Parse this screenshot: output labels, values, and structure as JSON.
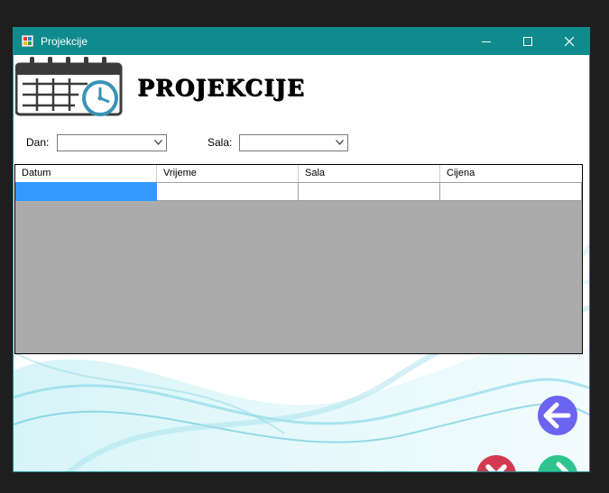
{
  "window": {
    "title": "Projekcije",
    "icon": "app-icon",
    "controls": [
      "minimize-icon",
      "maximize-icon",
      "close-icon"
    ]
  },
  "header": {
    "title": "PROJEKCIJE",
    "logo_icon": "calendar-clock-icon"
  },
  "filters": {
    "dan_label": "Dan:",
    "dan_value": "",
    "sala_label": "Sala:",
    "sala_value": ""
  },
  "grid": {
    "columns": [
      "Datum",
      "Vrijeme",
      "Sala",
      "Cijena"
    ],
    "rows": [
      [
        "",
        "",
        "",
        ""
      ]
    ],
    "selected_color": "#3399ff",
    "empty_area_color": "#ababab"
  },
  "actions": {
    "back_icon": "arrow-left-icon",
    "cancel_icon": "x-circle-icon",
    "next_icon": "arrow-right-icon"
  },
  "colors": {
    "titlebar": "#0f8b8d",
    "back_button": "#6a64f0",
    "cancel_button": "#d23a4f",
    "next_button": "#2fc48f"
  }
}
